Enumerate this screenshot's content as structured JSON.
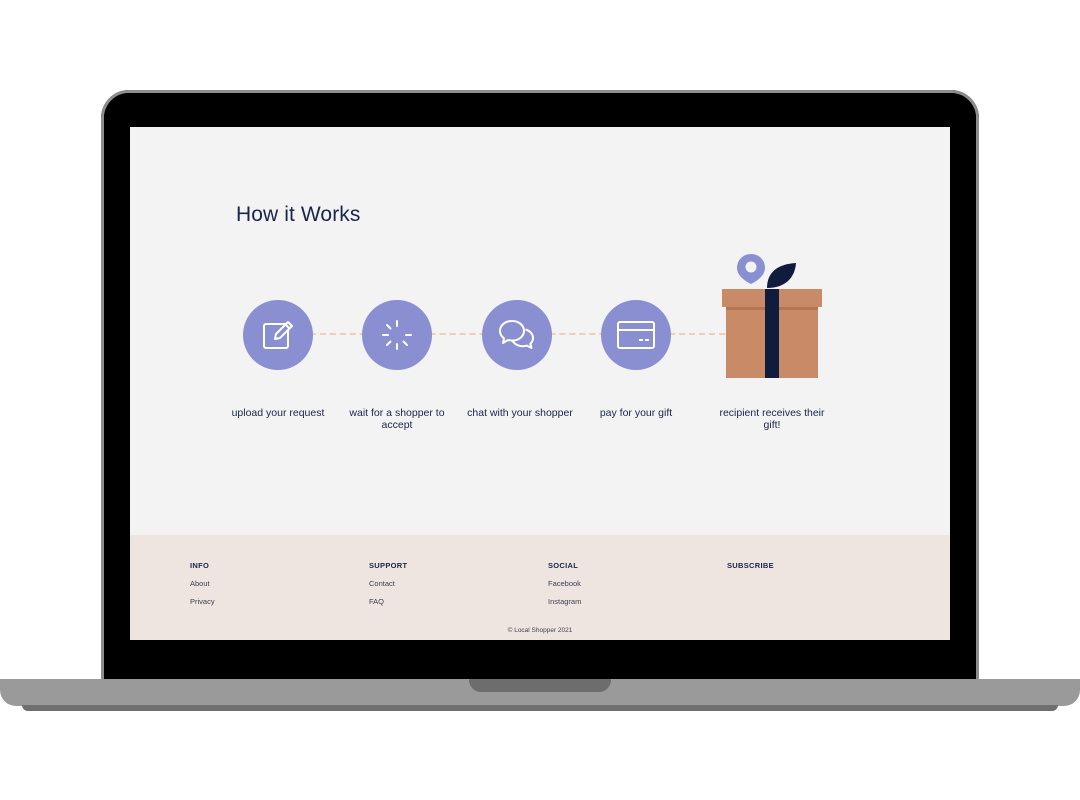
{
  "page": {
    "title": "How it Works"
  },
  "steps": [
    {
      "icon": "edit-icon",
      "label": "upload your request"
    },
    {
      "icon": "loading-spinner-icon",
      "label": "wait for a shopper to accept"
    },
    {
      "icon": "chat-bubbles-icon",
      "label": "chat with your shopper"
    },
    {
      "icon": "credit-card-icon",
      "label": "pay for your gift"
    },
    {
      "icon": "gift-box-icon",
      "label": "recipient receives their gift!"
    }
  ],
  "footer": {
    "info": {
      "title": "INFO",
      "links": [
        "About",
        "Privacy"
      ]
    },
    "support": {
      "title": "SUPPORT",
      "links": [
        "Contact",
        "FAQ"
      ]
    },
    "social": {
      "title": "SOCIAL",
      "links": [
        "Facebook",
        "Instagram"
      ]
    },
    "subscribe": {
      "title": "SUBSCRIBE"
    },
    "copyright": "© Local Shopper 2021"
  },
  "colors": {
    "accent": "#8a8fd1",
    "navy": "#1b2449",
    "gift_box": "#c98a68",
    "footer_bg": "#efe5e0",
    "dash": "#f2cdb3"
  }
}
